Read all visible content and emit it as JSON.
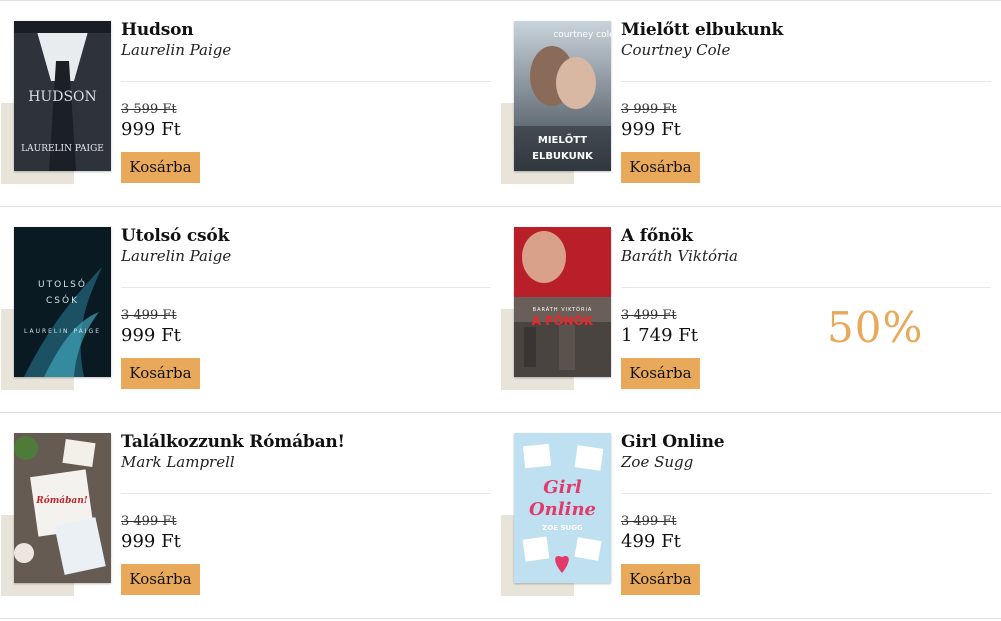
{
  "books": [
    {
      "title": "Hudson",
      "author": "Laurelin Paige",
      "old_price": "3 599 Ft",
      "price": "999 Ft",
      "button": "Kosárba",
      "cover_title": "HUDSON",
      "cover_author": "LAURELIN PAIGE",
      "cover_colors": [
        "#3a3f4a",
        "#1e222a"
      ]
    },
    {
      "title": "Mielőtt elbukunk",
      "author": "Courtney Cole",
      "old_price": "3 999 Ft",
      "price": "999 Ft",
      "button": "Kosárba",
      "cover_title": "MIELŐTT ELBUKUNK",
      "cover_author": "courtney cole",
      "cover_colors": [
        "#b7c7d6",
        "#5f6f7e"
      ]
    },
    {
      "title": "Utolsó csók",
      "author": "Laurelin Paige",
      "old_price": "3 499 Ft",
      "price": "999 Ft",
      "button": "Kosárba",
      "cover_title": "UTOLSÓ CSÓK",
      "cover_author": "LAURELIN PAIGE",
      "cover_colors": [
        "#0a1a22",
        "#173c4a"
      ]
    },
    {
      "title": "A főnök",
      "author": "Baráth Viktória",
      "old_price": "3 499 Ft",
      "price": "1 749 Ft",
      "button": "Kosárba",
      "discount": "50%",
      "cover_title": "A FŐNÖK",
      "cover_author": "BARÁTH VIKTÓRIA",
      "cover_colors": [
        "#b8222a",
        "#5b5048"
      ]
    },
    {
      "title": "Találkozzunk Rómában!",
      "author": "Mark Lamprell",
      "old_price": "3 499 Ft",
      "price": "999 Ft",
      "button": "Kosárba",
      "cover_title": "Rómában!",
      "cover_author": "",
      "cover_colors": [
        "#6e6258",
        "#3d352f"
      ]
    },
    {
      "title": "Girl Online",
      "author": "Zoe Sugg",
      "old_price": "3 499 Ft",
      "price": "499 Ft",
      "button": "Kosárba",
      "cover_title": "Girl Online",
      "cover_author": "ZOE SUGG",
      "cover_colors": [
        "#cfe6f2",
        "#a9d2ea"
      ]
    }
  ]
}
